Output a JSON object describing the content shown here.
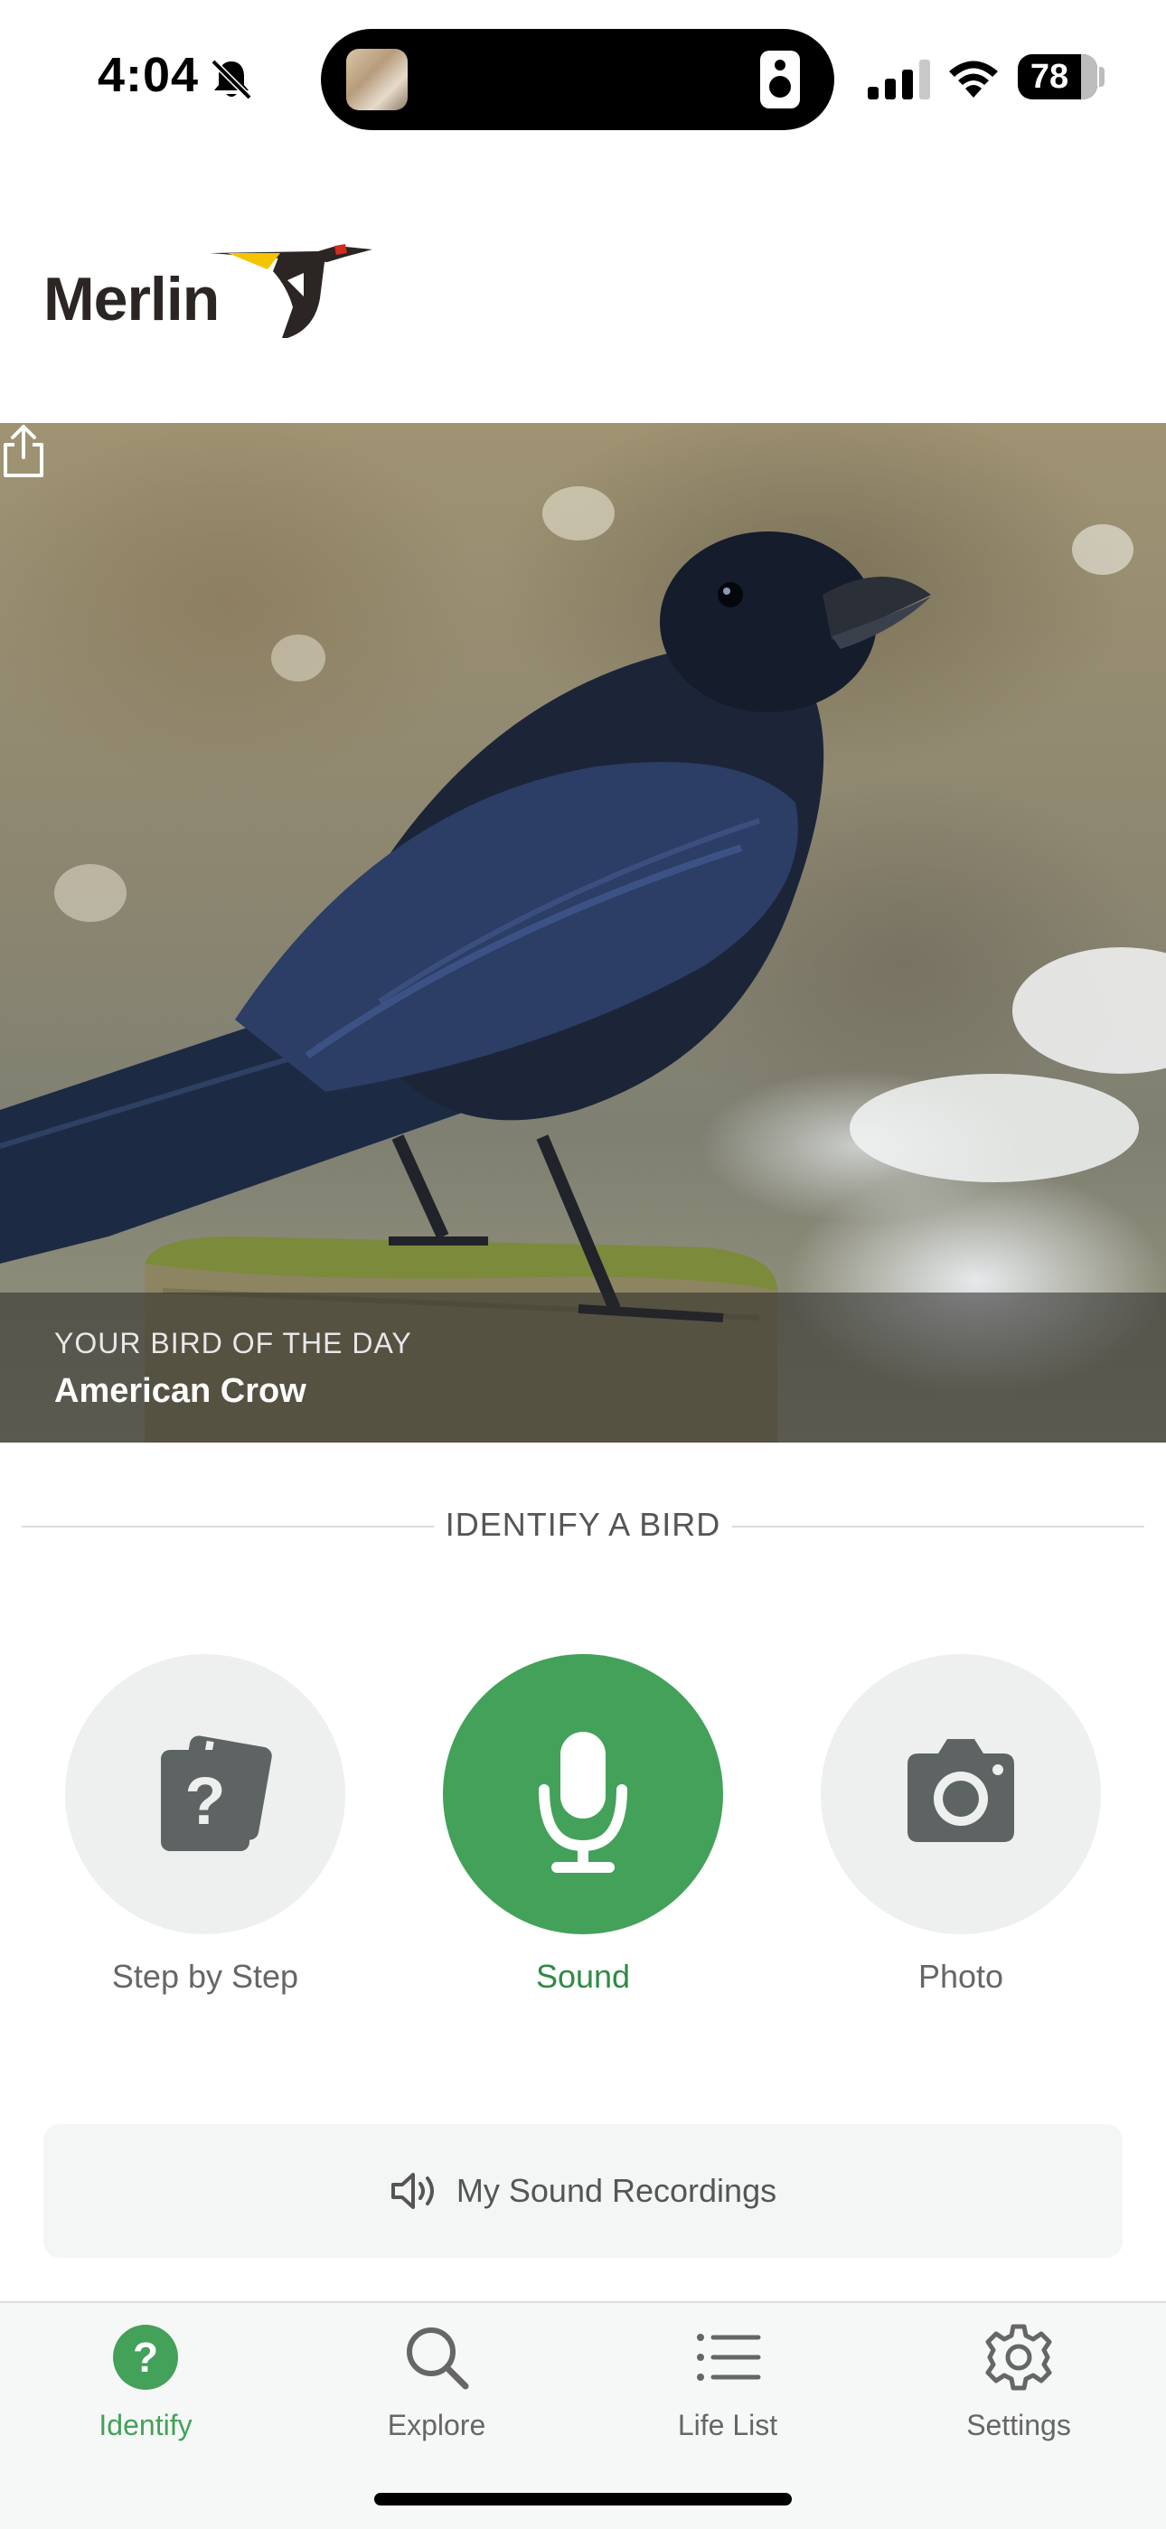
{
  "status_bar": {
    "time": "4:04",
    "battery": "78",
    "icons": [
      "bell-slash-icon",
      "signal-icon",
      "wifi-icon",
      "battery-icon",
      "speaker-icon"
    ]
  },
  "brand": {
    "logo_text": "Merlin"
  },
  "hero": {
    "caption_label": "YOUR BIRD OF THE DAY",
    "bird_name": "American Crow",
    "share_icon": "share-icon"
  },
  "identify": {
    "title": "IDENTIFY A BIRD",
    "options": [
      {
        "label": "Step by Step",
        "icon": "question-cards-icon",
        "active": false
      },
      {
        "label": "Sound",
        "icon": "microphone-icon",
        "active": true
      },
      {
        "label": "Photo",
        "icon": "camera-icon",
        "active": false
      }
    ],
    "recordings_label": "My Sound Recordings"
  },
  "tabs": [
    {
      "label": "Identify",
      "icon": "question-circle-icon",
      "active": true
    },
    {
      "label": "Explore",
      "icon": "search-icon",
      "active": false
    },
    {
      "label": "Life List",
      "icon": "list-icon",
      "active": false
    },
    {
      "label": "Settings",
      "icon": "gear-icon",
      "active": false
    }
  ],
  "colors": {
    "accent_green": "#43a159",
    "active_label_green": "#2f8a45",
    "circle_bg": "#edf0ef"
  }
}
